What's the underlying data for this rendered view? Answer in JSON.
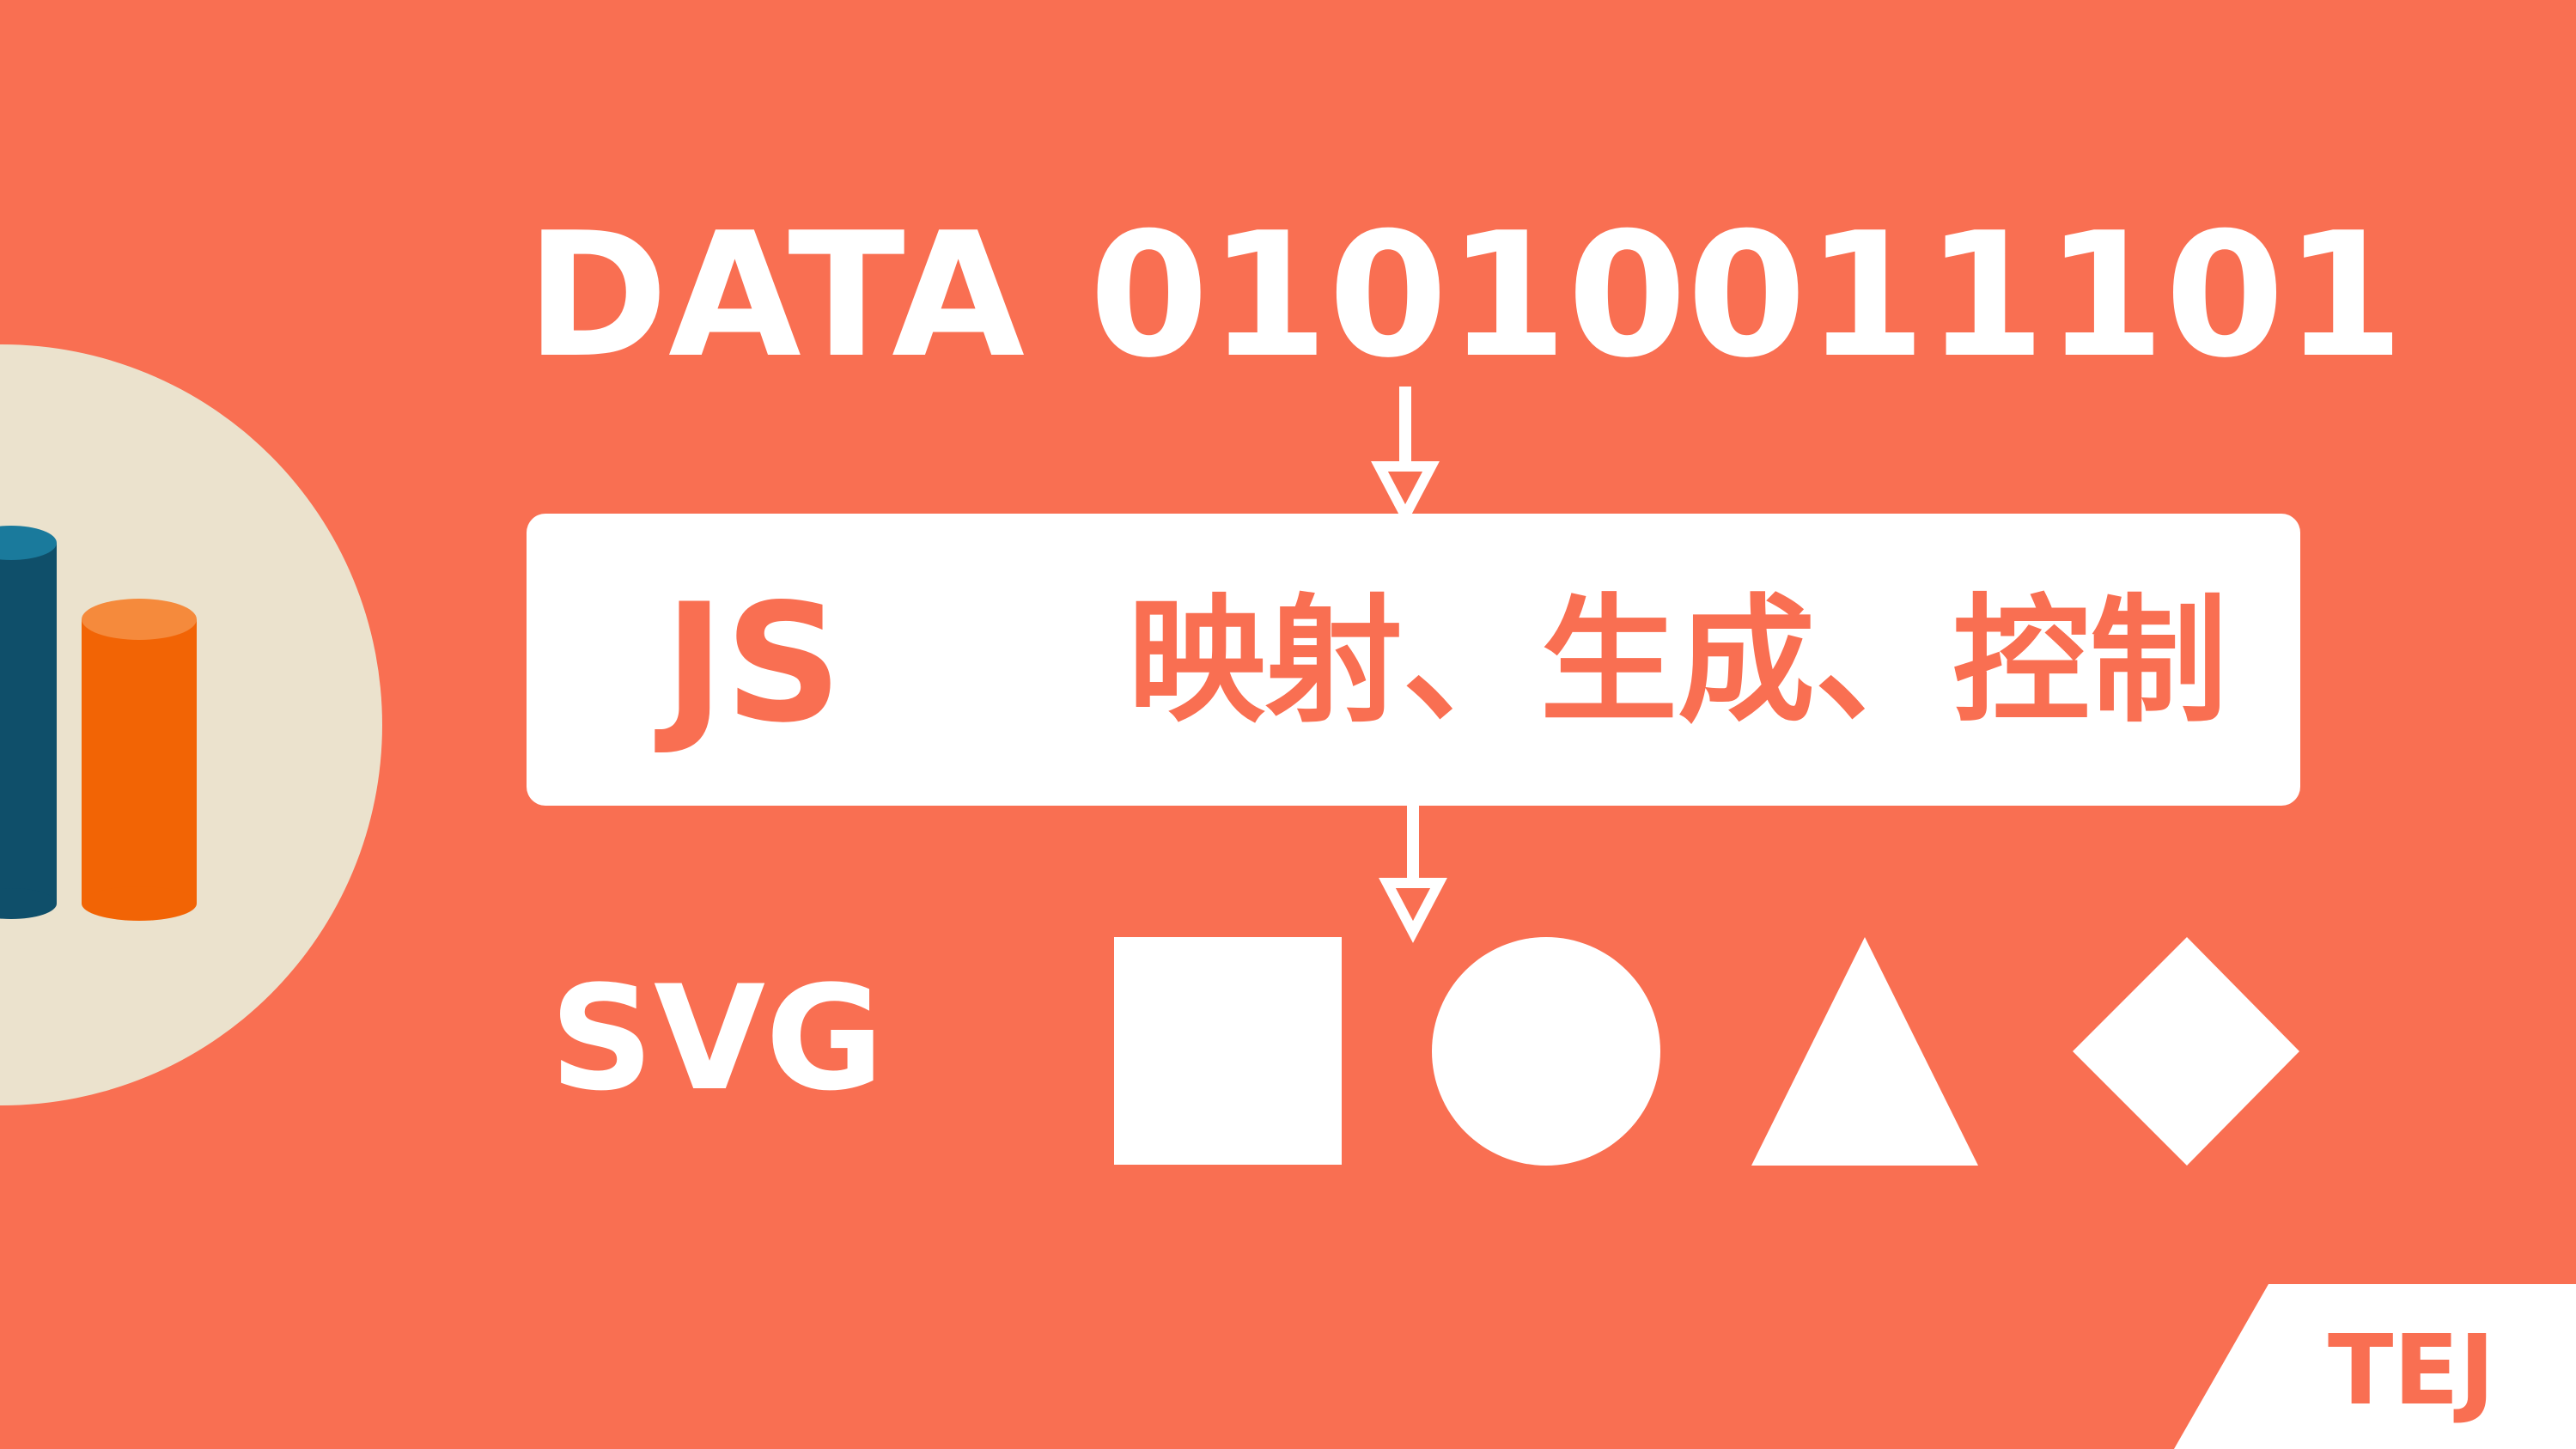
{
  "colors": {
    "background": "#f96f52",
    "foreground": "#ffffff",
    "circle": "#ebe2cd",
    "teal": "#0f4f6a",
    "orange": "#f26405"
  },
  "row_data": {
    "label": "DATA",
    "bits": "01010011101"
  },
  "row_js": {
    "label": "JS",
    "text": "映射、生成、控制"
  },
  "row_svg": {
    "label": "SVG",
    "shapes": [
      "square",
      "circle",
      "triangle",
      "diamond"
    ]
  },
  "corner": {
    "logo": "TEJ"
  }
}
